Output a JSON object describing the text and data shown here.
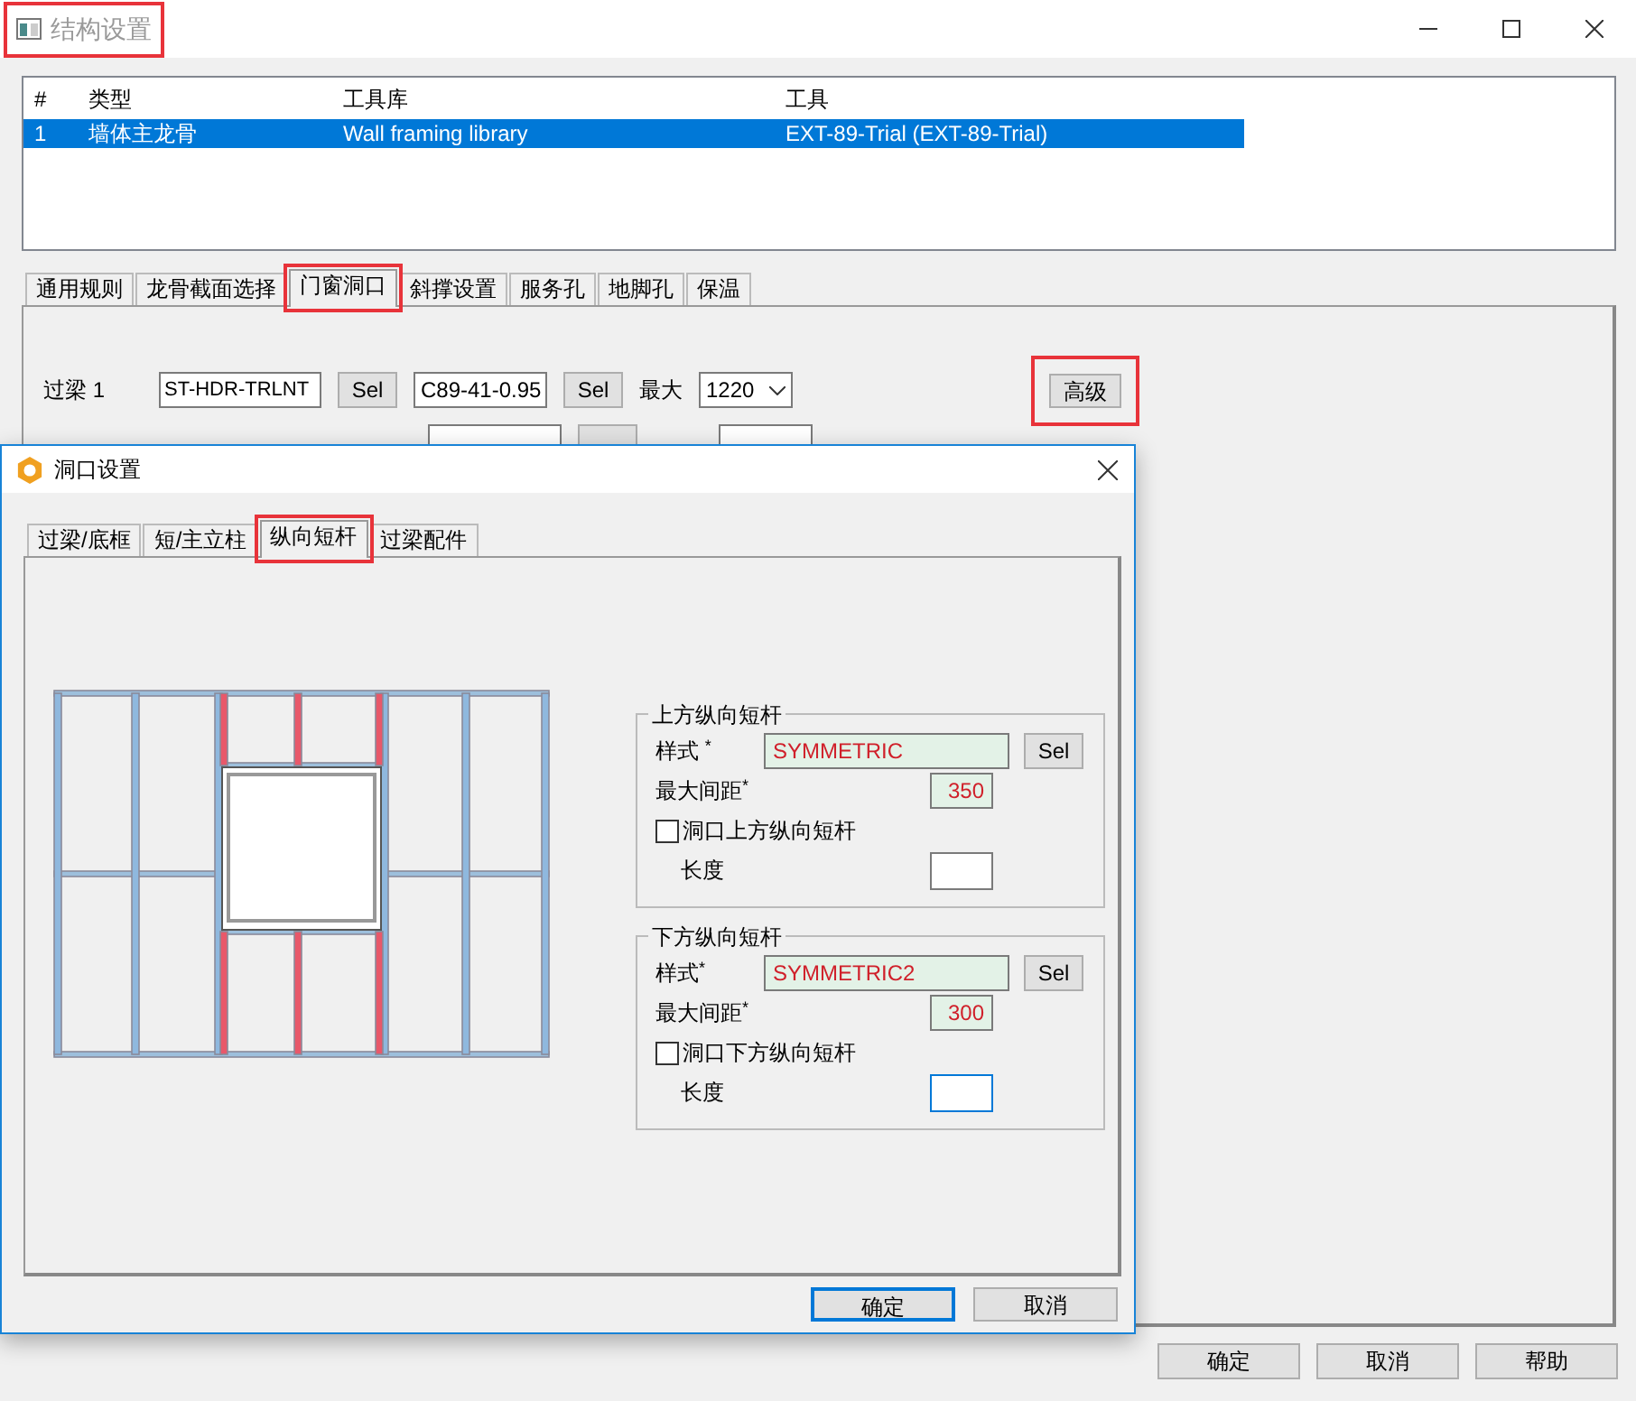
{
  "window": {
    "title": "结构设置",
    "highlighted": true
  },
  "list": {
    "columns": [
      "#",
      "类型",
      "工具库",
      "工具"
    ],
    "rows": [
      {
        "cells": [
          "1",
          "墙体主龙骨",
          "Wall framing library",
          "EXT-89-Trial (EXT-89-Trial)"
        ],
        "selected": true
      }
    ]
  },
  "tabs": [
    {
      "label": "通用规则",
      "selected": false,
      "highlighted": false
    },
    {
      "label": "龙骨截面选择",
      "selected": false,
      "highlighted": false
    },
    {
      "label": "门窗洞口",
      "selected": true,
      "highlighted": true
    },
    {
      "label": "斜撑设置",
      "selected": false,
      "highlighted": false
    },
    {
      "label": "服务孔",
      "selected": false,
      "highlighted": false
    },
    {
      "label": "地脚孔",
      "selected": false,
      "highlighted": false
    },
    {
      "label": "保温",
      "selected": false,
      "highlighted": false
    }
  ],
  "members": [
    {
      "label": "过梁 1",
      "profile": "ST-HDR-TRLNT",
      "profile_button": "Sel",
      "section": "C89-41-0.95",
      "section_button": "Sel",
      "option_label": "最大",
      "option_value": "1220"
    }
  ],
  "advanced_button": {
    "label": "高级",
    "highlighted": true
  },
  "dialog": {
    "title": "洞口设置",
    "tabs": [
      {
        "label": "过梁/底框",
        "selected": false,
        "highlighted": false
      },
      {
        "label": "短/主立柱",
        "selected": false,
        "highlighted": false
      },
      {
        "label": "纵向短杆",
        "selected": true,
        "highlighted": true
      },
      {
        "label": "过梁配件",
        "selected": false,
        "highlighted": false
      }
    ],
    "groups": [
      {
        "title": "上方纵向短杆",
        "style_label": "样式 $^{*}$",
        "style_value": "SYMMETRIC",
        "sel_button": "Sel",
        "spacing_label": "最大间距$^{*}$",
        "spacing_value": "350",
        "checkbox": {
          "label": "洞口上方纵向短杆",
          "checked": false
        },
        "length_label": "长度",
        "length_focused": false
      },
      {
        "title": "下方纵向短杆",
        "style_label": "样式$^{*}$",
        "style_value": "SYMMETRIC2",
        "sel_button": "Sel",
        "spacing_label": "最大间距$^{*}$",
        "spacing_value": "300",
        "checkbox": {
          "label": "洞口下方纵向短杆",
          "checked": false
        },
        "length_label": "长度",
        "length_focused": true
      }
    ],
    "buttons": [
      {
        "label": "确定",
        "default": true
      },
      {
        "label": "取消",
        "default": false
      }
    ]
  },
  "buttons": [
    "确定",
    "取消",
    "帮助"
  ]
}
